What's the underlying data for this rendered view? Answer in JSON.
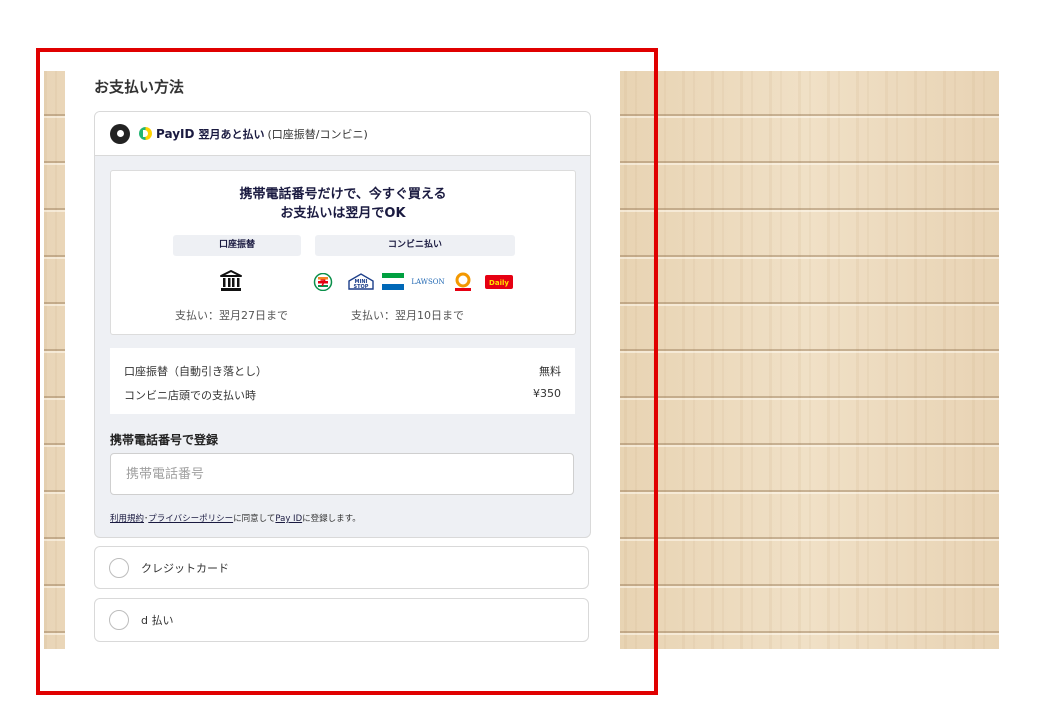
{
  "section_title": "お支払い方法",
  "payid_option": {
    "brand": "PayID",
    "brand_sub": "翌月あと払い",
    "note": "(口座振替/コンビニ)",
    "promo": {
      "line1": "携帯電話番号だけで、今すぐ買える",
      "line2": "お支払いは翌月でOK",
      "bank_tag": "口座振替",
      "store_tag": "コンビニ払い",
      "bank_deadline": "支払い：翌月27日まで",
      "store_deadline": "支払い：翌月10日まで",
      "stores": [
        "7",
        "MINI STOP",
        "FamilyMart",
        "LAWSON",
        "Seicomart",
        "Daily"
      ]
    },
    "fees": [
      {
        "label": "口座振替（自動引き落とし）",
        "value": "無料"
      },
      {
        "label": "コンビニ店頭での支払い時",
        "value": "¥350"
      }
    ],
    "register_label": "携帯電話番号で登録",
    "phone_placeholder": "携帯電話番号",
    "terms": {
      "link1": "利用規約",
      "sep": "･",
      "link2": "プライバシーポリシー",
      "mid": "に同意して",
      "link3": "Pay ID",
      "end": "に登録します。"
    }
  },
  "other_options": {
    "credit_card": "クレジットカード",
    "d_pay": "d 払い"
  },
  "colors": {
    "frame": "#e00000",
    "brand_navy": "#1a1a40",
    "payid_yellow": "#ffd200",
    "payid_green": "#22b573"
  }
}
